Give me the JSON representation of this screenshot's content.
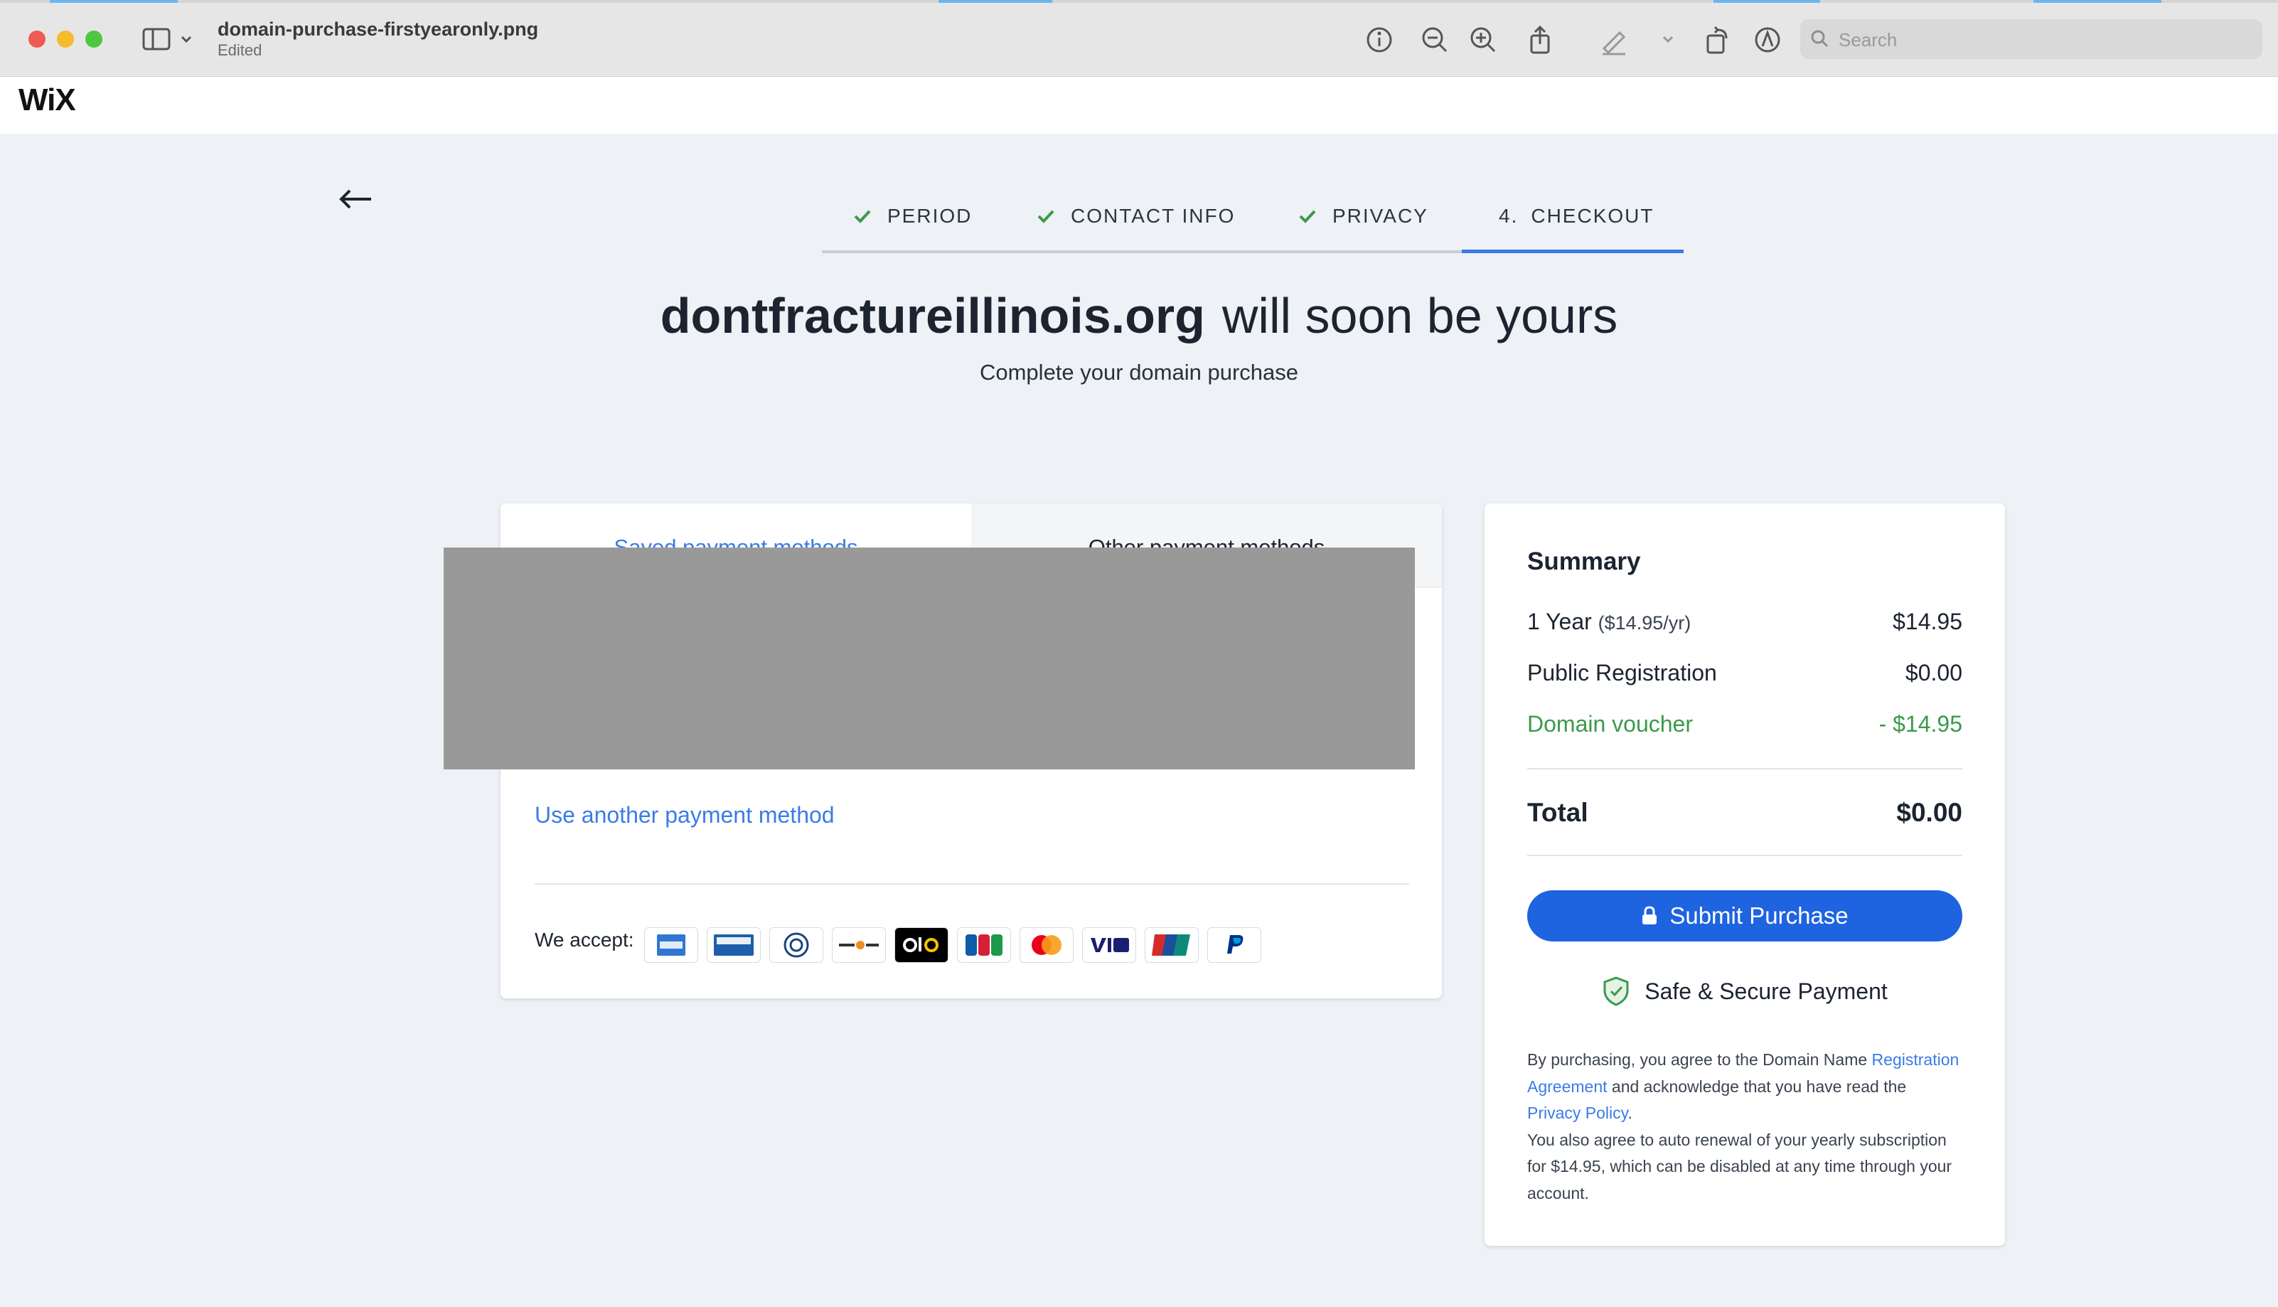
{
  "window": {
    "file_name": "domain-purchase-firstyearonly.png",
    "status": "Edited",
    "search_placeholder": "Search"
  },
  "brand": {
    "logo_text": "WiX"
  },
  "steps": [
    {
      "label": "PERIOD",
      "state": "complete"
    },
    {
      "label": "CONTACT INFO",
      "state": "complete"
    },
    {
      "label": "PRIVACY",
      "state": "complete"
    },
    {
      "number": "4.",
      "label": "CHECKOUT",
      "state": "active"
    }
  ],
  "headline": {
    "domain": "dontfractureillinois.org",
    "rest": "will soon be yours",
    "subtitle": "Complete your domain purchase"
  },
  "payment": {
    "tabs": [
      "Saved payment methods",
      "Other payment methods"
    ],
    "use_another": "Use another payment method",
    "accept_label": "We accept:",
    "card_logos": [
      "amex-icon",
      "carte-bleue-icon",
      "diners-icon",
      "discover-icon",
      "elo-icon",
      "jcb-icon",
      "mastercard-icon",
      "visa-icon",
      "unionpay-icon",
      "paypal-icon"
    ]
  },
  "summary": {
    "title": "Summary",
    "rows": {
      "year_label": "1 Year",
      "year_rate": "($14.95/yr)",
      "year_price": "$14.95",
      "public_label": "Public Registration",
      "public_price": "$0.00",
      "voucher_label": "Domain voucher",
      "voucher_price": "- $14.95"
    },
    "total_label": "Total",
    "total_value": "$0.00",
    "submit_label": "Submit Purchase",
    "secure_label": "Safe & Secure Payment",
    "legal": {
      "p1_a": "By purchasing, you agree to the Domain Name ",
      "link1": "Registration Agreement",
      "p1_b": " and acknowledge that you have read the ",
      "link2": "Privacy Policy",
      "p1_c": ".",
      "p2": "You also agree to auto renewal of your yearly subscription for $14.95, which can be disabled at any time through your account."
    }
  },
  "colors": {
    "accent": "#3b7be8",
    "button": "#1e63e0",
    "success": "#3a9a4a",
    "redacted": "#999999"
  }
}
